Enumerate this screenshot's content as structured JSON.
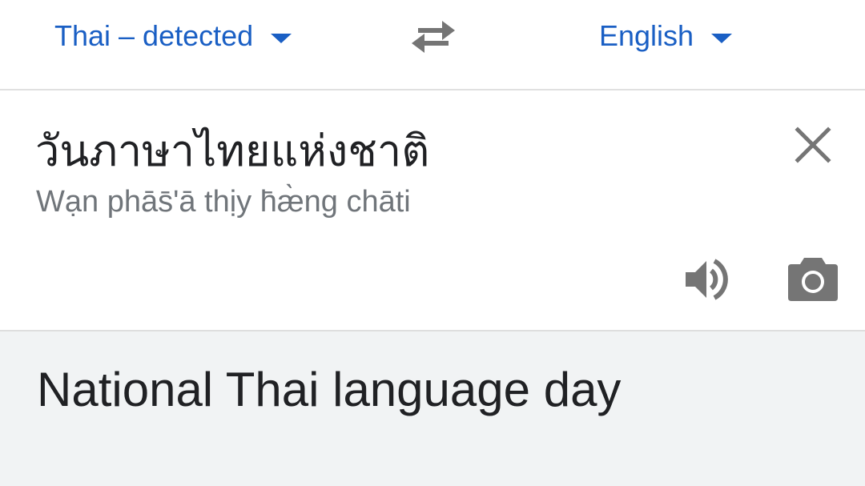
{
  "language_bar": {
    "source_language": "Thai – detected",
    "target_language": "English",
    "swap_icon": "swap-arrows-icon"
  },
  "source": {
    "text": "วันภาษาไทยแห่งชาติ",
    "transliteration": "Wạn phās̄ʹā thịy h̄æ̀ng chāti",
    "clear_icon": "close-icon",
    "speak_icon": "speaker-icon",
    "camera_icon": "camera-icon"
  },
  "translation": {
    "text": "National Thai language day"
  },
  "colors": {
    "accent": "#1a5fc4",
    "icon_gray": "#757575",
    "result_background": "#f1f3f4"
  }
}
